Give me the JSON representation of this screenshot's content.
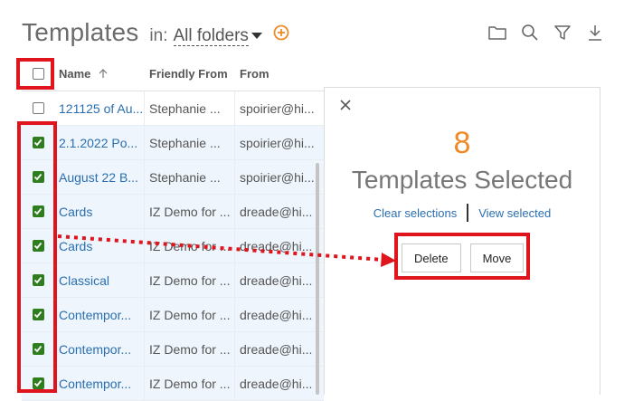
{
  "header": {
    "title": "Templates",
    "in_label": "in:",
    "folder": "All folders"
  },
  "table": {
    "columns": {
      "name": "Name",
      "friendly_from": "Friendly From",
      "from": "From"
    },
    "rows": [
      {
        "name": "121125 of Au...",
        "friendly_from": "Stephanie ...",
        "from": "spoirier@hi...",
        "checked": false
      },
      {
        "name": "2.1.2022 Po...",
        "friendly_from": "Stephanie ...",
        "from": "spoirier@hi...",
        "checked": true
      },
      {
        "name": "August 22 B...",
        "friendly_from": "Stephanie ...",
        "from": "spoirier@hi...",
        "checked": true
      },
      {
        "name": "Cards",
        "friendly_from": "IZ Demo for ...",
        "from": "dreade@hi...",
        "checked": true
      },
      {
        "name": "Cards",
        "friendly_from": "IZ Demo for ...",
        "from": "dreade@hi...",
        "checked": true
      },
      {
        "name": "Classical",
        "friendly_from": "IZ Demo for ...",
        "from": "dreade@hi...",
        "checked": true
      },
      {
        "name": "Contempor...",
        "friendly_from": "IZ Demo for ...",
        "from": "dreade@hi...",
        "checked": true
      },
      {
        "name": "Contempor...",
        "friendly_from": "IZ Demo for ...",
        "from": "dreade@hi...",
        "checked": true
      },
      {
        "name": "Contempor...",
        "friendly_from": "IZ Demo for ...",
        "from": "dreade@hi...",
        "checked": true
      }
    ]
  },
  "panel": {
    "count": "8",
    "label": "Templates Selected",
    "clear": "Clear selections",
    "view": "View selected",
    "delete": "Delete",
    "move": "Move"
  },
  "colors": {
    "accent_orange": "#f08a28",
    "link_blue": "#2a6fb0",
    "check_green": "#2e7d1f",
    "highlight_red": "#e0141c"
  }
}
